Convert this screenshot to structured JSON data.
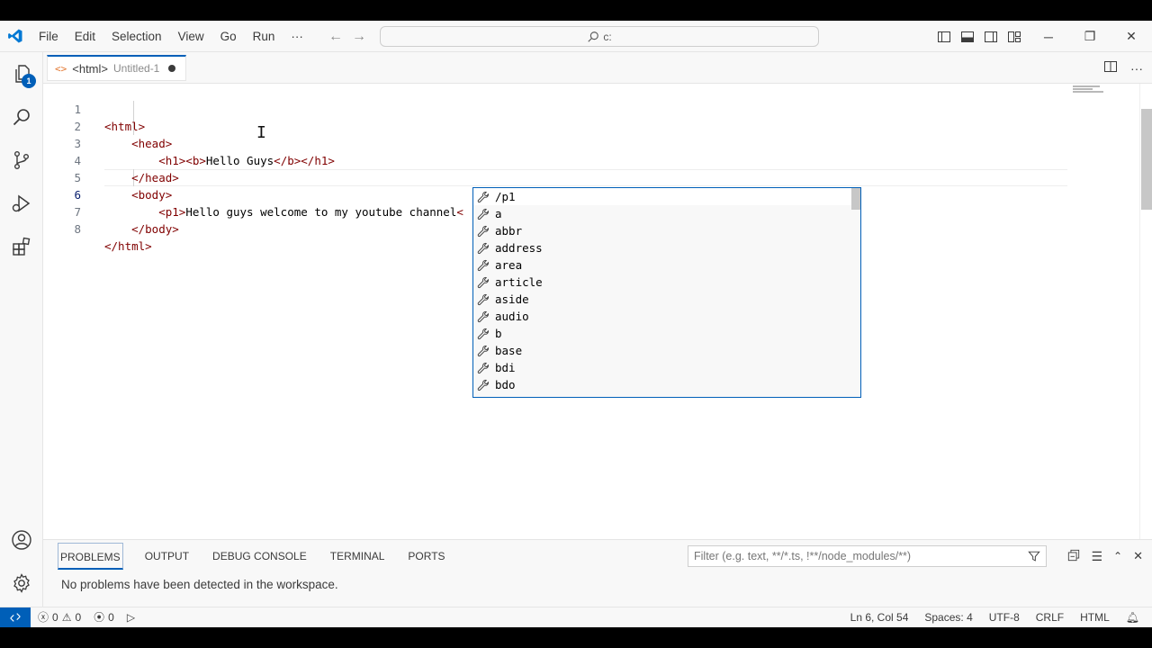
{
  "menu": {
    "items": [
      "File",
      "Edit",
      "Selection",
      "View",
      "Go",
      "Run"
    ],
    "more": "···"
  },
  "command_center": {
    "text": "c:"
  },
  "activity": {
    "explorer_badge": "1"
  },
  "tab": {
    "icon_text": "<>",
    "title": "<html>",
    "description": "Untitled-1"
  },
  "editor": {
    "lines": [
      {
        "num": "1",
        "text": "<html>"
      },
      {
        "num": "2",
        "text": "    <head>"
      },
      {
        "num": "3",
        "text": "        <h1><b>Hello Guys</b></h1>"
      },
      {
        "num": "4",
        "text": "    </head>"
      },
      {
        "num": "5",
        "text": "    <body>"
      },
      {
        "num": "6",
        "text": "        <p1>Hello guys welcome to my youtube channel<"
      },
      {
        "num": "7",
        "text": "    </body>"
      },
      {
        "num": "8",
        "text": "</html>"
      }
    ]
  },
  "suggestions": [
    "/p1",
    "a",
    "abbr",
    "address",
    "area",
    "article",
    "aside",
    "audio",
    "b",
    "base",
    "bdi",
    "bdo"
  ],
  "panel": {
    "tabs": [
      "PROBLEMS",
      "OUTPUT",
      "DEBUG CONSOLE",
      "TERMINAL",
      "PORTS"
    ],
    "filter_placeholder": "Filter (e.g. text, **/*.ts, !**/node_modules/**)",
    "message": "No problems have been detected in the workspace."
  },
  "status": {
    "errors": "0",
    "warnings": "0",
    "ports": "0",
    "position": "Ln 6, Col 54",
    "spaces": "Spaces: 4",
    "encoding": "UTF-8",
    "eol": "CRLF",
    "language": "HTML"
  },
  "colors": {
    "accent": "#005fb8",
    "tag": "#800000",
    "html_icon": "#e37933"
  }
}
